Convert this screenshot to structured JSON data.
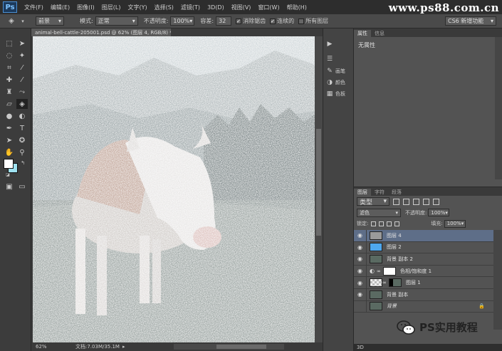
{
  "menubar": {
    "logo": "Ps",
    "items": [
      "文件(F)",
      "编辑(E)",
      "图像(I)",
      "图层(L)",
      "文字(Y)",
      "选择(S)",
      "滤镜(T)",
      "3D(D)",
      "视图(V)",
      "窗口(W)",
      "帮助(H)"
    ],
    "watermark": "www.ps88.com.cn"
  },
  "options": {
    "preset": "前景",
    "mode_label": "模式:",
    "mode_value": "正常",
    "opacity_label": "不透明度:",
    "opacity_value": "100%",
    "tolerance_label": "容差:",
    "tolerance_value": "32",
    "antialias_label": "消除锯齿",
    "contiguous_label": "连续的",
    "all_layers_label": "所有图层",
    "workspace": "CS6 新增功能"
  },
  "document": {
    "tab_title": "animal-bell-cattle-205001.psd @ 62% (图层 4, RGB/8) *",
    "zoom": "62%",
    "doc_info": "文档:7.03M/35.1M"
  },
  "mid_panel": {
    "items": [
      {
        "icon": "play-icon",
        "label": ""
      },
      {
        "icon": "list-icon",
        "label": ""
      },
      {
        "icon": "brush-icon",
        "label": "画笔"
      },
      {
        "icon": "adjust-icon",
        "label": "颜色"
      },
      {
        "icon": "swatch-icon",
        "label": "色板"
      }
    ]
  },
  "properties": {
    "tabs": [
      "属性",
      "信息"
    ],
    "no_properties": "无属性"
  },
  "layers_panel": {
    "tabs": [
      "图层",
      "字符",
      "段落"
    ],
    "filter": "类型",
    "blend_mode": "滤色",
    "opacity_label": "不透明度:",
    "opacity_value": "100%",
    "lock_label": "锁定:",
    "fill_label": "填充:",
    "fill_value": "100%",
    "layers": [
      {
        "name": "图层 4",
        "selected": true,
        "thumb": "#9a9a9a",
        "visible": true
      },
      {
        "name": "图层 2",
        "selected": false,
        "thumb": "#4ea7ee",
        "visible": true
      },
      {
        "name": "背景 副本 2",
        "selected": false,
        "thumb": "#5a6a62",
        "visible": true
      },
      {
        "name": "色相/饱和度 1",
        "selected": false,
        "thumb": "#ffffff",
        "visible": true
      },
      {
        "name": "图层 1",
        "selected": false,
        "thumb": "#cfcfcf",
        "visible": true
      },
      {
        "name": "背景 副本",
        "selected": false,
        "thumb": "#5a6a62",
        "visible": true
      },
      {
        "name": "背景",
        "selected": false,
        "thumb": "#5a6a62",
        "visible": false
      }
    ],
    "bottom_tab": "3D"
  },
  "wechat": {
    "label": "PS实用教程"
  }
}
